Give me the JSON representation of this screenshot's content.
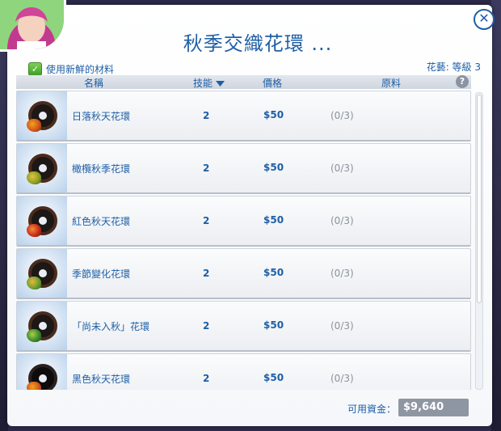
{
  "window": {
    "title": "秋季交織花環 ..."
  },
  "controls": {
    "close_glyph": "✕",
    "fresh_ingredients_label": "使用新鮮的材料",
    "fresh_checked": true,
    "check_glyph": "✓",
    "skill_level": "花藝: 等級 3"
  },
  "columns": {
    "name": "名稱",
    "skill": "技能",
    "price": "價格",
    "ingredients": "原料",
    "help_glyph": "?"
  },
  "rows": [
    {
      "name": "日落秋天花環",
      "skill": "2",
      "price": "$50",
      "ingredients": "(0/3)",
      "icon": "sunset-autumn-wreath-icon"
    },
    {
      "name": "橄欖秋季花環",
      "skill": "2",
      "price": "$50",
      "ingredients": "(0/3)",
      "icon": "olive-autumn-wreath-icon"
    },
    {
      "name": "紅色秋天花環",
      "skill": "2",
      "price": "$50",
      "ingredients": "(0/3)",
      "icon": "red-autumn-wreath-icon"
    },
    {
      "name": "季節變化花環",
      "skill": "2",
      "price": "$50",
      "ingredients": "(0/3)",
      "icon": "seasonal-change-wreath-icon"
    },
    {
      "name": "「尚未入秋」花環",
      "skill": "2",
      "price": "$50",
      "ingredients": "(0/3)",
      "icon": "not-yet-autumn-wreath-icon"
    },
    {
      "name": "黑色秋天花環",
      "skill": "2",
      "price": "$50",
      "ingredients": "(0/3)",
      "icon": "black-autumn-wreath-icon"
    }
  ],
  "footer": {
    "funds_label": "可用資金：",
    "funds_value": "$9,640"
  },
  "colors": {
    "accent": "#1e5fa6",
    "check_green": "#4fae32",
    "funds_box": "#8f96a3"
  }
}
